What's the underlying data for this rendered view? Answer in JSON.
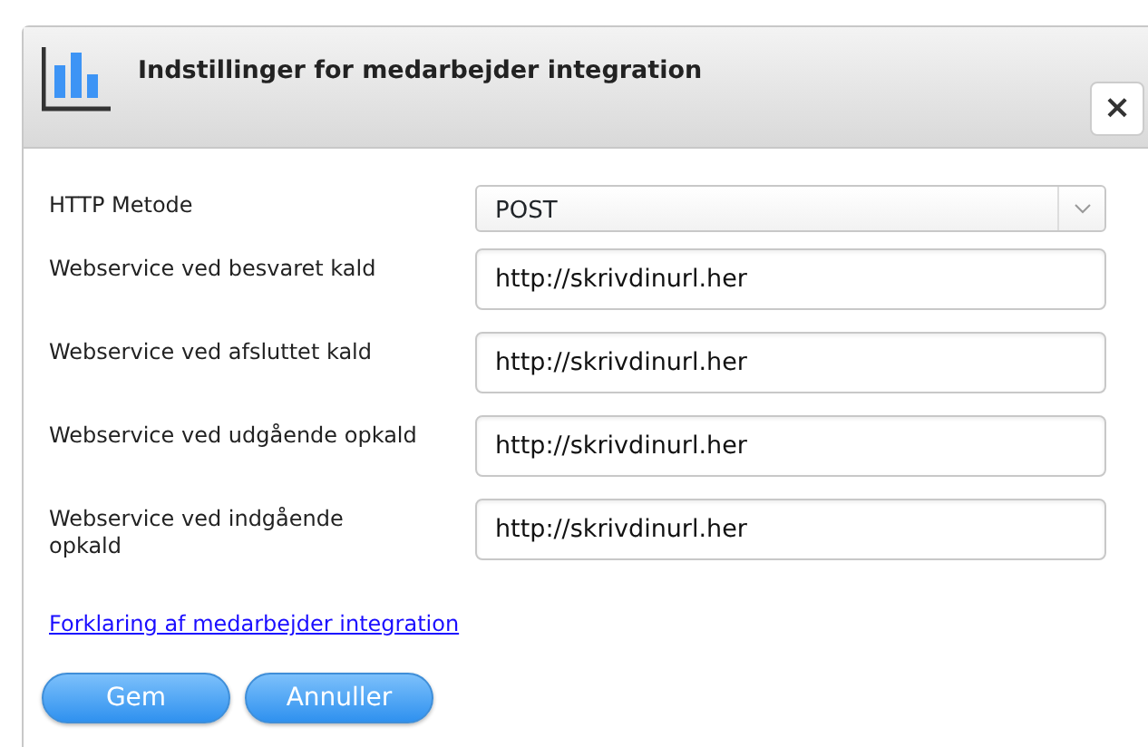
{
  "dialog": {
    "title": "Indstillinger for medarbejder integration",
    "close": "×"
  },
  "fields": [
    {
      "kind": "select",
      "label": "HTTP Metode",
      "value": "POST"
    },
    {
      "kind": "text",
      "label": "Webservice ved besvaret kald",
      "value": "http://skrivdinurl.her"
    },
    {
      "kind": "text",
      "label": "Webservice ved afsluttet kald",
      "value": "http://skrivdinurl.her"
    },
    {
      "kind": "text",
      "label": "Webservice ved udgående opkald",
      "value": "http://skrivdinurl.her"
    },
    {
      "kind": "text",
      "label": "Webservice ved indgående opkald",
      "value": "http://skrivdinurl.her"
    }
  ],
  "link": "Forklaring af medarbejder integration",
  "buttons": [
    "Gem",
    "Annuller"
  ]
}
